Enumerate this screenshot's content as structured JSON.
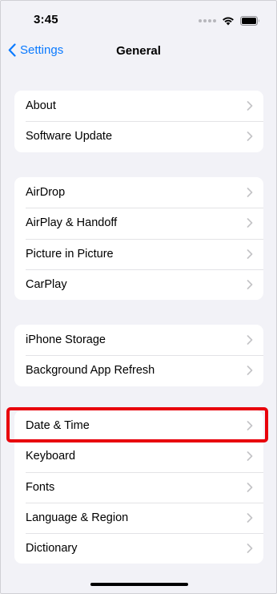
{
  "status_bar": {
    "time": "3:45",
    "icons": [
      "cellular-signal-icon",
      "wifi-icon",
      "battery-icon"
    ]
  },
  "nav": {
    "back_label": "Settings",
    "title": "General"
  },
  "groups": [
    {
      "rows": [
        {
          "label": "About"
        },
        {
          "label": "Software Update"
        }
      ]
    },
    {
      "rows": [
        {
          "label": "AirDrop"
        },
        {
          "label": "AirPlay & Handoff"
        },
        {
          "label": "Picture in Picture"
        },
        {
          "label": "CarPlay"
        }
      ]
    },
    {
      "rows": [
        {
          "label": "iPhone Storage"
        },
        {
          "label": "Background App Refresh"
        }
      ]
    },
    {
      "rows": [
        {
          "label": "Date & Time"
        },
        {
          "label": "Keyboard"
        },
        {
          "label": "Fonts"
        },
        {
          "label": "Language & Region"
        },
        {
          "label": "Dictionary"
        }
      ]
    }
  ],
  "highlighted_row": "Date & Time",
  "colors": {
    "accent": "#0a7aff",
    "highlight": "#e8000b",
    "background": "#f2f2f7"
  }
}
